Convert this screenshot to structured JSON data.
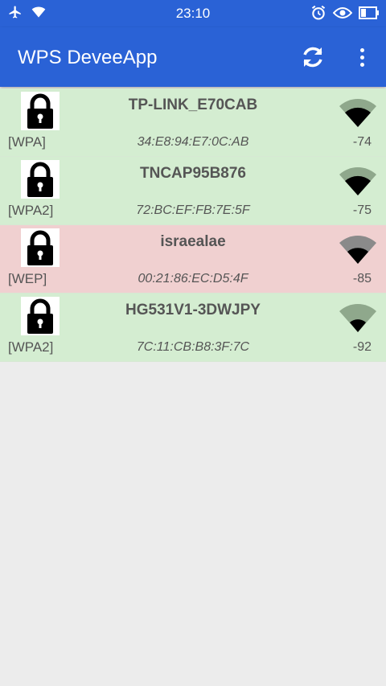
{
  "status_bar": {
    "time": "23:10",
    "left_icons": [
      "airplane-mode-icon",
      "wifi-status-icon"
    ],
    "right_icons": [
      "alarm-icon",
      "eye-icon",
      "battery-icon"
    ]
  },
  "app_bar": {
    "title": "WPS DeveeApp",
    "actions": [
      "refresh-icon",
      "overflow-menu-icon"
    ],
    "color": "#2a62d6"
  },
  "networks": [
    {
      "ssid": "TP-LINK_E70CAB",
      "security": "[WPA]",
      "bssid": "34:E8:94:E7:0C:AB",
      "rssi": "-74",
      "status": "secure"
    },
    {
      "ssid": "TNCAP95B876",
      "security": "[WPA2]",
      "bssid": "72:BC:EF:FB:7E:5F",
      "rssi": "-75",
      "status": "secure"
    },
    {
      "ssid": "israealae",
      "security": "[WEP]",
      "bssid": "00:21:86:EC:D5:4F",
      "rssi": "-85",
      "status": "danger"
    },
    {
      "ssid": "HG531V1-3DWJPY",
      "security": "[WPA2]",
      "bssid": "7C:11:CB:B8:3F:7C",
      "rssi": "-92",
      "status": "secure"
    }
  ],
  "colors": {
    "secure_row": "#d4edd1",
    "danger_row": "#f0d0d0",
    "background": "#ececec"
  }
}
